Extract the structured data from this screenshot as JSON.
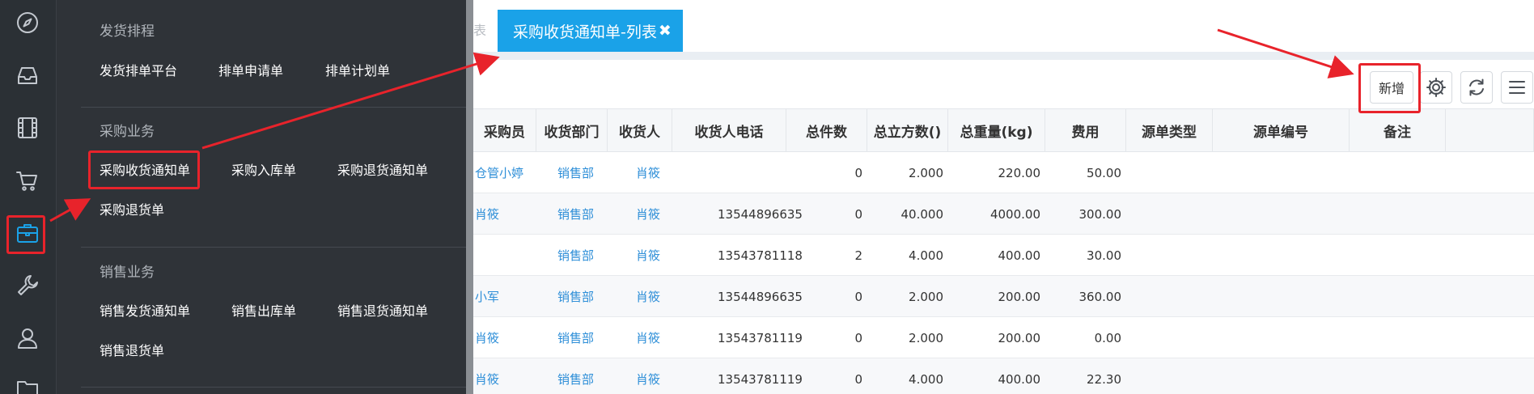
{
  "rail": {
    "icons": [
      "compass-icon",
      "inbox-icon",
      "film-icon",
      "cart-icon",
      "briefcase-icon",
      "wrench-icon",
      "user-icon",
      "folder-icon"
    ]
  },
  "menu": {
    "sections": [
      {
        "heading": "发货排程",
        "items": [
          "发货排单平台",
          "排单申请单",
          "排单计划单"
        ]
      },
      {
        "heading": "采购业务",
        "items": [
          "采购收货通知单",
          "采购入库单",
          "采购退货通知单",
          "采购退货单"
        ]
      },
      {
        "heading": "销售业务",
        "items": [
          "销售发货通知单",
          "销售出库单",
          "销售退货通知单",
          "销售退货单"
        ]
      }
    ]
  },
  "tabs": {
    "prev_fragment": "表",
    "active_label": "采购收货通知单-列表",
    "close_glyph": "✖"
  },
  "toolbar": {
    "add_label": "新增",
    "icons": [
      "gear-icon",
      "refresh-icon",
      "menu-icon"
    ]
  },
  "table": {
    "columns": [
      "采购员",
      "收货部门",
      "收货人",
      "收货人电话",
      "总件数",
      "总立方数()",
      "总重量(kg)",
      "费用",
      "源单类型",
      "源单编号",
      "备注"
    ],
    "rows": [
      {
        "buyer": "仓管小婷",
        "dept": "销售部",
        "receiver": "肖筱",
        "phone": "",
        "qty": "0",
        "volume": "2.000",
        "weight": "220.00",
        "fee": "50.00"
      },
      {
        "buyer": "肖筱",
        "dept": "销售部",
        "receiver": "肖筱",
        "phone": "13544896635",
        "qty": "0",
        "volume": "40.000",
        "weight": "4000.00",
        "fee": "300.00"
      },
      {
        "buyer": "",
        "dept": "销售部",
        "receiver": "肖筱",
        "phone": "13543781118",
        "qty": "2",
        "volume": "4.000",
        "weight": "400.00",
        "fee": "30.00"
      },
      {
        "buyer": "小军",
        "dept": "销售部",
        "receiver": "肖筱",
        "phone": "13544896635",
        "qty": "0",
        "volume": "2.000",
        "weight": "200.00",
        "fee": "360.00"
      },
      {
        "buyer": "肖筱",
        "dept": "销售部",
        "receiver": "肖筱",
        "phone": "13543781119",
        "qty": "0",
        "volume": "2.000",
        "weight": "200.00",
        "fee": "0.00"
      },
      {
        "buyer": "肖筱",
        "dept": "销售部",
        "receiver": "肖筱",
        "phone": "13543781119",
        "qty": "0",
        "volume": "4.000",
        "weight": "400.00",
        "fee": "22.30"
      }
    ]
  },
  "colors": {
    "accent": "#1aa2e8",
    "annotation": "#e8232b",
    "sidebar": "#2b3035",
    "flyout": "#2f3338",
    "link": "#2f8fd8"
  }
}
